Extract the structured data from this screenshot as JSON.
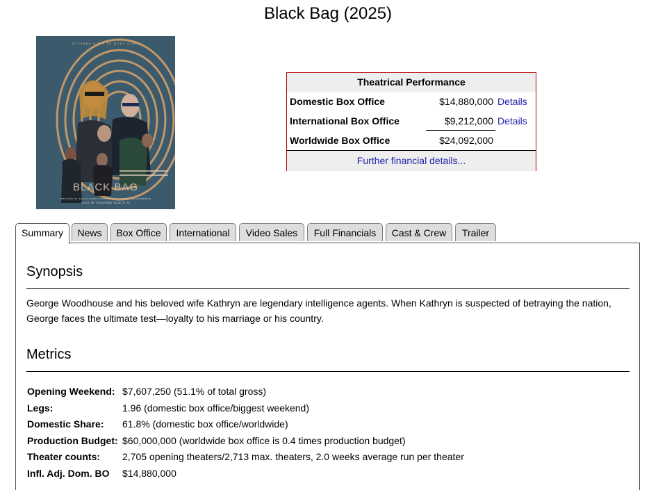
{
  "page": {
    "title": "Black Bag (2025)"
  },
  "poster": {
    "tagline": "IT TAKES A SPY TO HUNT A SPY",
    "logo": "BLACK BAG",
    "credits": "WRITTEN BY DAVID KOEPP   DIRECTED BY STEVEN SODERBERGH",
    "release": "ONLY IN THEATERS MARCH 14",
    "colors": {
      "background": "#3b5a6b",
      "fingerprint": "#d9a36a"
    }
  },
  "performance": {
    "heading": "Theatrical Performance",
    "rows": [
      {
        "label": "Domestic Box Office",
        "amount": "$14,880,000",
        "link": "Details"
      },
      {
        "label": "International Box Office",
        "amount": "$9,212,000",
        "link": "Details"
      },
      {
        "label": "Worldwide Box Office",
        "amount": "$24,092,000",
        "link": ""
      }
    ],
    "footer_link": "Further financial details...",
    "border_color": "#b30000",
    "link_color": "#2222aa"
  },
  "tabs": [
    {
      "label": "Summary",
      "active": true
    },
    {
      "label": "News"
    },
    {
      "label": "Box Office"
    },
    {
      "label": "International"
    },
    {
      "label": "Video Sales"
    },
    {
      "label": "Full Financials"
    },
    {
      "label": "Cast & Crew"
    },
    {
      "label": "Trailer"
    }
  ],
  "summary": {
    "synopsis_title": "Synopsis",
    "synopsis_text": "George Woodhouse and his beloved wife Kathryn are legendary intelligence agents. When Kathryn is suspected of betraying the nation, George faces the ultimate test—loyalty to his marriage or his country.",
    "metrics_title": "Metrics",
    "metrics": [
      {
        "key": "Opening Weekend:",
        "value": "$7,607,250 (51.1% of total gross)"
      },
      {
        "key": "Legs:",
        "value": "1.96 (domestic box office/biggest weekend)"
      },
      {
        "key": "Domestic Share:",
        "value": "61.8% (domestic box office/worldwide)"
      },
      {
        "key": "Production Budget:",
        "value": "$60,000,000 (worldwide box office is 0.4 times production budget)"
      },
      {
        "key": "Theater counts:",
        "value": "2,705 opening theaters/2,713 max. theaters, 2.0 weeks average run per theater"
      },
      {
        "key": "Infl. Adj. Dom. BO",
        "value": "$14,880,000"
      }
    ]
  }
}
